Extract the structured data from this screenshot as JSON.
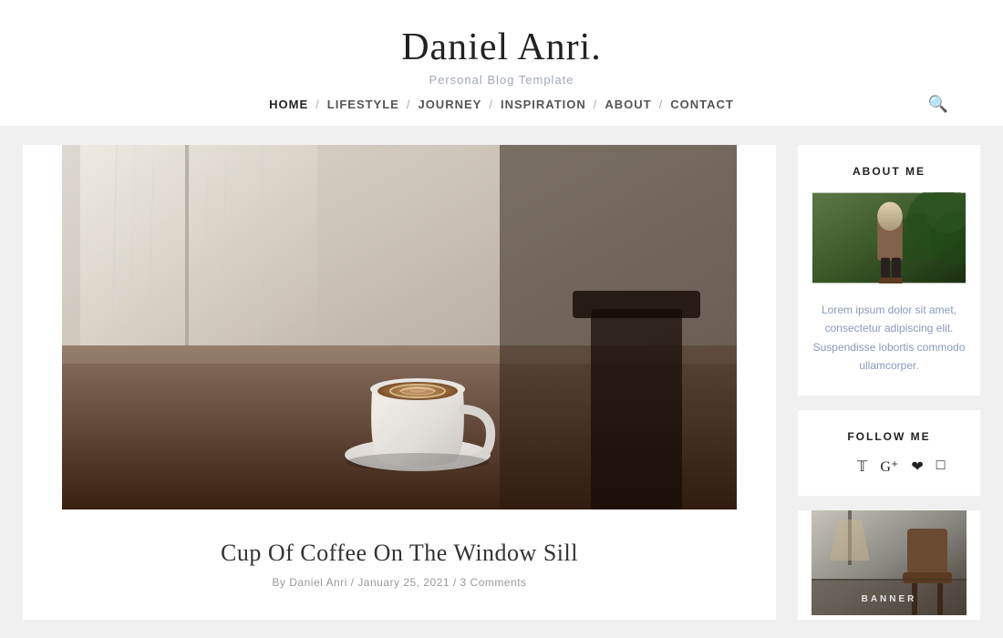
{
  "site": {
    "title": "Daniel Anri.",
    "subtitle": "Personal Blog Template"
  },
  "nav": {
    "links": [
      {
        "label": "HOME",
        "active": true
      },
      {
        "label": "LIFESTYLE",
        "active": false
      },
      {
        "label": "JOURNEY",
        "active": false
      },
      {
        "label": "INSPIRATION",
        "active": false
      },
      {
        "label": "ABOUT",
        "active": false
      },
      {
        "label": "CONTACT",
        "active": false
      }
    ]
  },
  "post": {
    "title": "Cup Of Coffee On The Window Sill",
    "meta": "By Daniel Anri / January 25, 2021 / 3 Comments"
  },
  "sidebar": {
    "about_heading": "ABOUT ME",
    "about_text": "Lorem ipsum dolor sit amet, consectetur adipiscing elit. Suspendisse lobortis commodo ullamcorper.",
    "follow_heading": "FOLLOW ME",
    "banner_label": "BANNER"
  }
}
